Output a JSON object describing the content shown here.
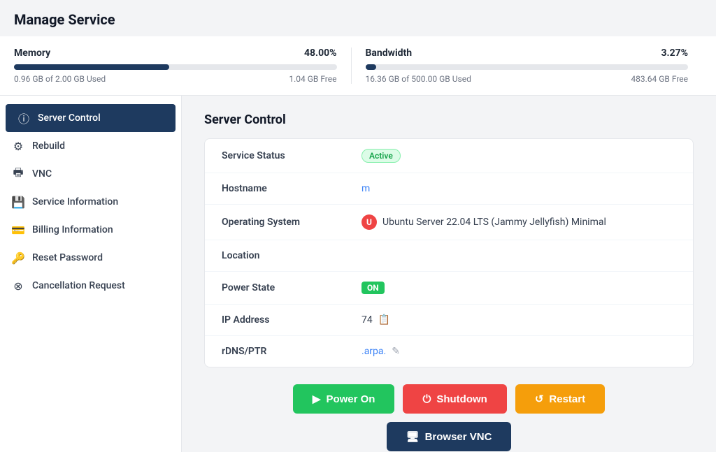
{
  "page": {
    "title": "Manage Service"
  },
  "stats": [
    {
      "label": "Memory",
      "percent": "48.00%",
      "fill_width": 48,
      "used": "0.96 GB of 2.00 GB Used",
      "free": "1.04 GB Free"
    },
    {
      "label": "Bandwidth",
      "percent": "3.27%",
      "fill_width": 3.27,
      "used": "16.36 GB of 500.00 GB Used",
      "free": "483.64 GB Free"
    }
  ],
  "sidebar": {
    "items": [
      {
        "id": "server-control",
        "label": "Server Control",
        "icon": "ℹ",
        "active": true
      },
      {
        "id": "rebuild",
        "label": "Rebuild",
        "icon": "⚙",
        "active": false
      },
      {
        "id": "vnc",
        "label": "VNC",
        "icon": "🖥",
        "active": false
      },
      {
        "id": "service-information",
        "label": "Service Information",
        "icon": "💾",
        "active": false
      },
      {
        "id": "billing-information",
        "label": "Billing Information",
        "icon": "💳",
        "active": false
      },
      {
        "id": "reset-password",
        "label": "Reset Password",
        "icon": "🔑",
        "active": false
      },
      {
        "id": "cancellation-request",
        "label": "Cancellation Request",
        "icon": "⊗",
        "active": false
      }
    ]
  },
  "main": {
    "section_title": "Server Control",
    "rows": [
      {
        "key": "Service Status",
        "value": "Active",
        "type": "badge-active"
      },
      {
        "key": "Hostname",
        "value": "m",
        "type": "link"
      },
      {
        "key": "Operating System",
        "value": "Ubuntu Server 22.04 LTS (Jammy Jellyfish) Minimal",
        "type": "os"
      },
      {
        "key": "Location",
        "value": "",
        "type": "text"
      },
      {
        "key": "Power State",
        "value": "ON",
        "type": "badge-on"
      },
      {
        "key": "IP Address",
        "value": "74",
        "type": "copy"
      },
      {
        "key": "rDNS/PTR",
        "value": ".arpa.",
        "type": "edit"
      }
    ],
    "buttons": {
      "power_on": "Power On",
      "shutdown": "Shutdown",
      "restart": "Restart",
      "browser_vnc": "Browser VNC"
    }
  }
}
